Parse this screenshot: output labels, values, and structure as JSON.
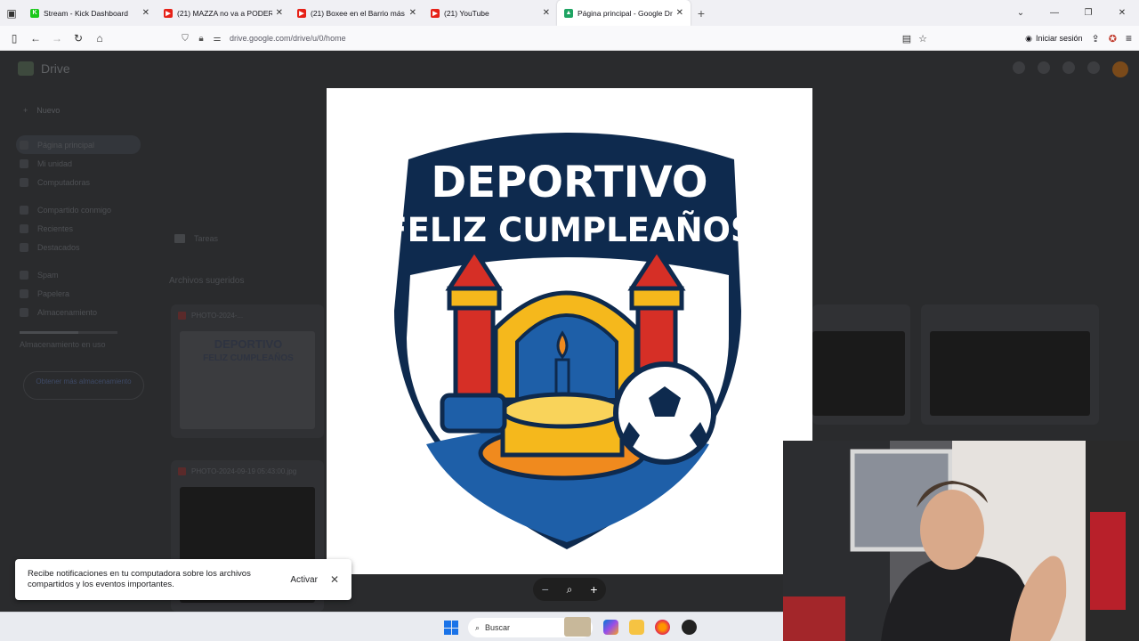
{
  "browser": {
    "tabs": [
      {
        "label": "Stream - Kick Dashboard",
        "favicon_color": "#1ac81a",
        "active": false
      },
      {
        "label": "(21) MAZZA no va a PODER con",
        "favicon_color": "#e62117",
        "active": false
      },
      {
        "label": "(21) Boxee en el Barrio más Peli",
        "favicon_color": "#e62117",
        "active": false
      },
      {
        "label": "(21) YouTube",
        "favicon_color": "#e62117",
        "active": false
      },
      {
        "label": "Página principal - Google Drive",
        "favicon_color": "#1fa463",
        "active": true
      }
    ],
    "url": "drive.google.com/drive/u/0/home",
    "signin_label": "Iniciar sesión"
  },
  "drive": {
    "app_name": "Drive",
    "new_label": "Nuevo",
    "nav": [
      "Página principal",
      "Mi unidad",
      "Computadoras",
      "Compartido conmigo",
      "Recientes",
      "Destacados",
      "Spam",
      "Papelera",
      "Almacenamiento"
    ],
    "storage_text": "Almacenamiento en uso",
    "storage_button": "Obtener más almacenamiento",
    "folder_name": "Tareas",
    "section_title": "Archivos sugeridos",
    "files": [
      "PHOTO-2024-...",
      "PHOTO-2024-09-19 05:43:00.jpg"
    ]
  },
  "viewer": {
    "crest_line1": "DEPORTIVO",
    "crest_line2": "FELIZ CUMPLEAÑOS",
    "colors": {
      "navy": "#0e2a4e",
      "red": "#d62f26",
      "yellow": "#f5b81c",
      "blue": "#1e5fa8",
      "orange": "#f08a1e"
    }
  },
  "notification": {
    "message": "Recibe notificaciones en tu computadora sobre los archivos compartidos y los eventos importantes.",
    "action": "Activar"
  },
  "taskbar": {
    "search_placeholder": "Buscar"
  }
}
